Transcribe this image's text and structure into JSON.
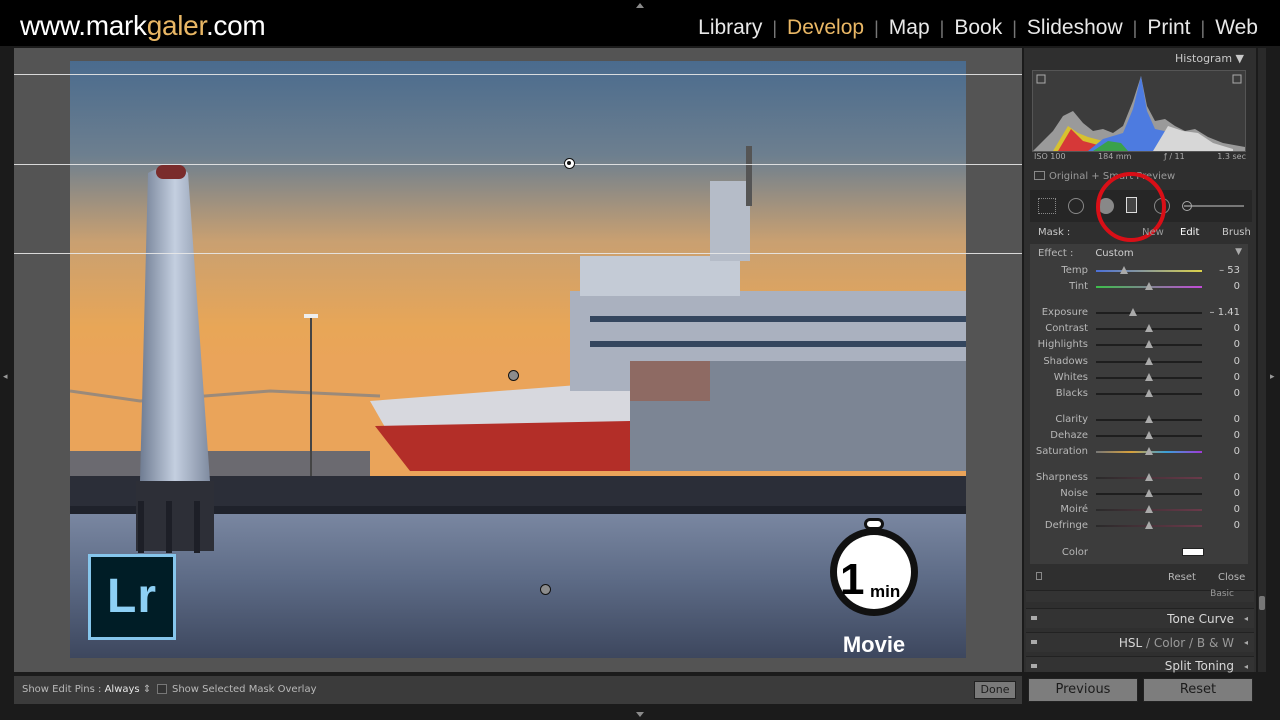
{
  "header": {
    "site_prefix": "www.mark",
    "site_highlight": "galer",
    "site_suffix": ".com",
    "modules": [
      "Library",
      "Develop",
      "Map",
      "Book",
      "Slideshow",
      "Print",
      "Web"
    ],
    "active_module": "Develop",
    "separator": "|"
  },
  "histogram": {
    "title": "Histogram",
    "iso": "ISO 100",
    "focal": "184 mm",
    "aperture": "ƒ / 11",
    "shutter": "1.3 sec",
    "preview_label": "Original + Smart Preview"
  },
  "mask": {
    "label": "Mask :",
    "new": "New",
    "edit": "Edit",
    "brush": "Brush"
  },
  "effect": {
    "label": "Effect :",
    "preset": "Custom",
    "sliders": [
      {
        "label": "Temp",
        "value": "– 53",
        "pos": 0.26
      },
      {
        "label": "Tint",
        "value": "0",
        "pos": 0.5
      },
      {
        "label": "Exposure",
        "value": "– 1.41",
        "pos": 0.35
      },
      {
        "label": "Contrast",
        "value": "0",
        "pos": 0.5
      },
      {
        "label": "Highlights",
        "value": "0",
        "pos": 0.5
      },
      {
        "label": "Shadows",
        "value": "0",
        "pos": 0.5
      },
      {
        "label": "Whites",
        "value": "0",
        "pos": 0.5
      },
      {
        "label": "Blacks",
        "value": "0",
        "pos": 0.5
      },
      {
        "label": "Clarity",
        "value": "0",
        "pos": 0.5
      },
      {
        "label": "Dehaze",
        "value": "0",
        "pos": 0.5
      },
      {
        "label": "Saturation",
        "value": "0",
        "pos": 0.5
      },
      {
        "label": "Sharpness",
        "value": "0",
        "pos": 0.5
      },
      {
        "label": "Noise",
        "value": "0",
        "pos": 0.5
      },
      {
        "label": "Moiré",
        "value": "0",
        "pos": 0.5
      },
      {
        "label": "Defringe",
        "value": "0",
        "pos": 0.5
      }
    ],
    "color_label": "Color",
    "reset": "Reset",
    "close": "Close"
  },
  "panels": {
    "basic": "Basic",
    "tone_curve": "Tone Curve",
    "hsl": "HSL",
    "hsl_color": "Color",
    "hsl_bw": "B & W",
    "split_toning": "Split Toning",
    "hsl_sep": "/"
  },
  "bottom": {
    "previous": "Previous",
    "reset": "Reset",
    "show_edit_pins_label": "Show Edit Pins :",
    "show_edit_pins_value": "Always",
    "show_overlay": "Show Selected Mask Overlay",
    "done": "Done"
  },
  "overlay": {
    "logo_text": "Lr",
    "timer_number": "1",
    "timer_unit": "min",
    "movie": "Movie"
  },
  "colors": {
    "accent": "#e9b765",
    "red_circle": "#d90f17",
    "lr_blue": "#86c6ec"
  }
}
